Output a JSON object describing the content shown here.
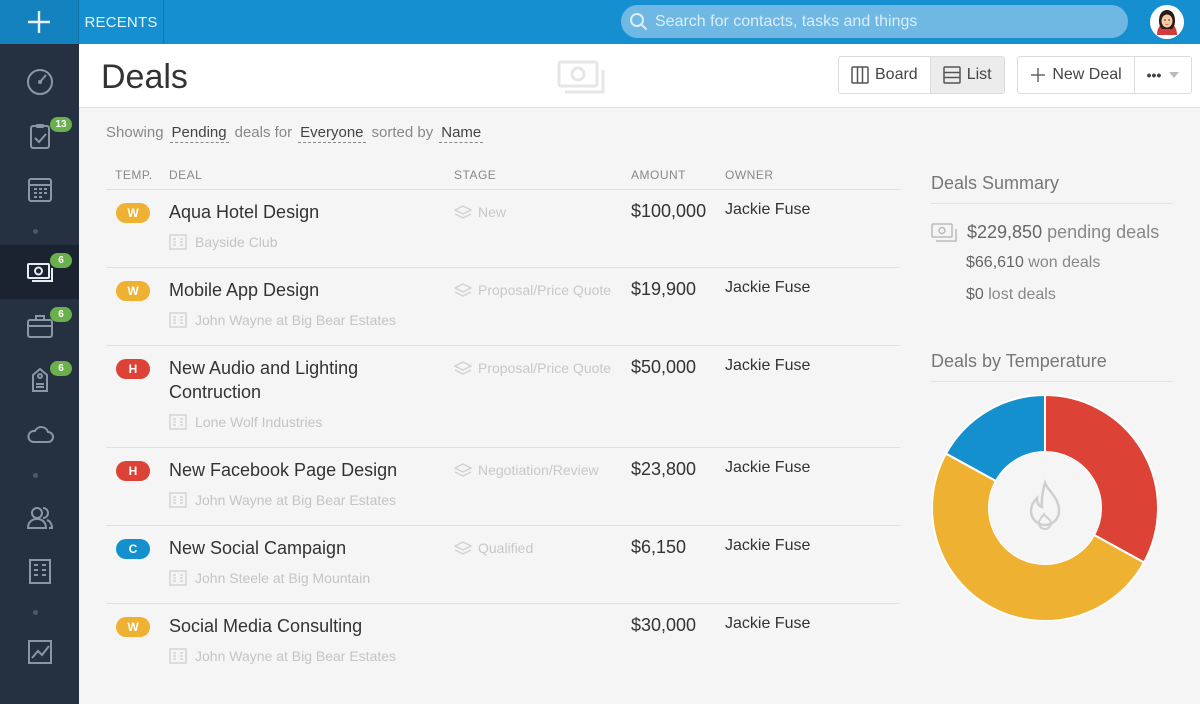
{
  "topbar": {
    "recents_label": "RECENTS",
    "search_placeholder": "Search for contacts, tasks and things"
  },
  "sidebar": {
    "items": [
      {
        "icon": "dashboard-icon",
        "badge": ""
      },
      {
        "icon": "tasks-icon",
        "badge": "13"
      },
      {
        "icon": "calendar-icon",
        "badge": ""
      },
      {
        "icon": "deals-icon",
        "badge": "6",
        "active": true
      },
      {
        "icon": "projects-icon",
        "badge": "6"
      },
      {
        "icon": "leads-icon",
        "badge": "6"
      },
      {
        "icon": "cloud-icon",
        "badge": ""
      },
      {
        "icon": "contacts-icon",
        "badge": ""
      },
      {
        "icon": "companies-icon",
        "badge": ""
      },
      {
        "icon": "reports-icon",
        "badge": ""
      }
    ]
  },
  "header": {
    "title": "Deals",
    "board_label": "Board",
    "list_label": "List",
    "new_deal_label": "New Deal",
    "more_label": "•••"
  },
  "filter": {
    "showing": "Showing",
    "status": "Pending",
    "deals_for": "deals for",
    "who": "Everyone",
    "sorted_by": "sorted by",
    "sort": "Name"
  },
  "table": {
    "columns": [
      "TEMP.",
      "DEAL",
      "STAGE",
      "AMOUNT",
      "OWNER"
    ],
    "rows": [
      {
        "temp": "W",
        "name": "Aqua Hotel Design",
        "company": "Bayside Club",
        "stage": "New",
        "amount": "$100,000",
        "owner": "Jackie Fuse"
      },
      {
        "temp": "W",
        "name": "Mobile App Design",
        "company": "John Wayne at Big Bear Estates",
        "stage": "Proposal/Price Quote",
        "amount": "$19,900",
        "owner": "Jackie Fuse"
      },
      {
        "temp": "H",
        "name": "New Audio and Lighting Contruction",
        "company": "Lone Wolf Industries",
        "stage": "Proposal/Price Quote",
        "amount": "$50,000",
        "owner": "Jackie Fuse"
      },
      {
        "temp": "H",
        "name": "New Facebook Page Design",
        "company": "John Wayne at Big Bear Estates",
        "stage": "Negotiation/Review",
        "amount": "$23,800",
        "owner": "Jackie Fuse"
      },
      {
        "temp": "C",
        "name": "New Social Campaign",
        "company": "John Steele at Big Mountain",
        "stage": "Qualified",
        "amount": "$6,150",
        "owner": "Jackie Fuse"
      },
      {
        "temp": "W",
        "name": "Social Media Consulting",
        "company": "John Wayne at Big Bear Estates",
        "stage": "",
        "amount": "$30,000",
        "owner": "Jackie Fuse"
      }
    ]
  },
  "colors": {
    "hot": "#dc4336",
    "warm": "#eeb132",
    "cold": "#1590cf",
    "topbar": "#168fd0",
    "sidebar": "#253141"
  },
  "summary": {
    "title": "Deals Summary",
    "pending_amount": "$229,850",
    "pending_label": "pending deals",
    "won_amount": "$66,610",
    "won_label": "won deals",
    "lost_amount": "$0",
    "lost_label": "lost deals"
  },
  "temperature_chart": {
    "title": "Deals by Temperature",
    "segments": [
      {
        "name": "H",
        "share": 0.33,
        "color": "#dc4336"
      },
      {
        "name": "W",
        "share": 0.5,
        "color": "#eeb132"
      },
      {
        "name": "C",
        "share": 0.17,
        "color": "#1590cf"
      }
    ]
  }
}
